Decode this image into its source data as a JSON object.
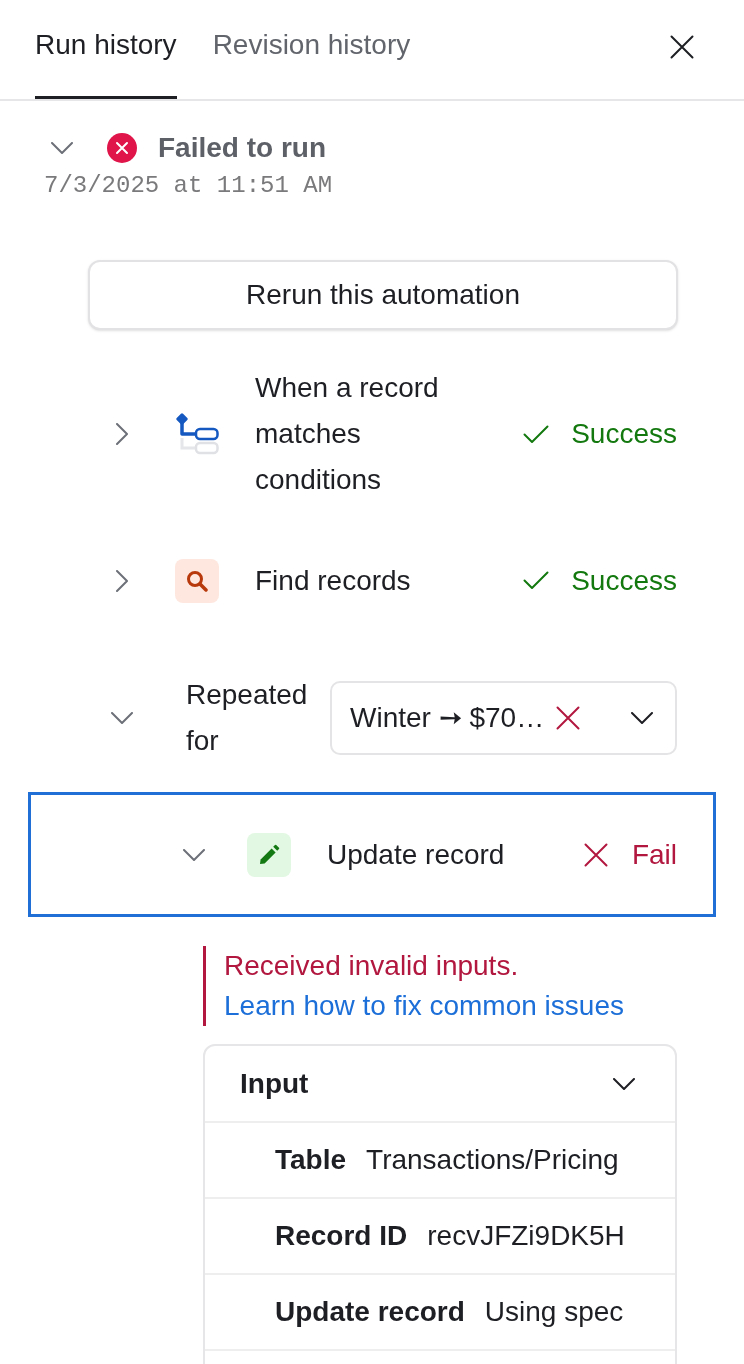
{
  "tabs": [
    {
      "label": "Run history",
      "selected": true
    },
    {
      "label": "Revision history",
      "selected": false
    }
  ],
  "run": {
    "failed": true,
    "title": "Failed to run",
    "timestamp": "7/3/2025 at 11:51 AM",
    "expanded": true
  },
  "rerun_button": {
    "label": "Rerun this automation"
  },
  "steps": [
    {
      "kind": "trigger",
      "label": "When a record matches conditions",
      "expanded": false,
      "selected": false,
      "failed": false,
      "status_label": "Success"
    },
    {
      "kind": "find",
      "label": "Find records",
      "expanded": false,
      "selected": false,
      "failed": false,
      "status_label": "Success"
    },
    {
      "kind": "repeat",
      "label": "Repeated for",
      "expanded": true,
      "selected": false,
      "dropdown": {
        "value": "Winter ➙ $70…",
        "failed": true
      },
      "children": [
        {
          "kind": "update",
          "label": "Update record",
          "expanded": true,
          "selected": true,
          "failed": true,
          "status_label": "Fail",
          "error": {
            "message": "Received invalid inputs.",
            "link": "Learn how to fix common issues"
          },
          "input": {
            "title": "Input",
            "expanded": true,
            "rows": [
              {
                "label": "Table",
                "value": "Transactions/Pricing"
              },
              {
                "label": "Record ID",
                "value": "recvJFZi9DK5H"
              },
              {
                "label": "Update record",
                "value": "Using spec"
              }
            ]
          }
        }
      ]
    }
  ]
}
